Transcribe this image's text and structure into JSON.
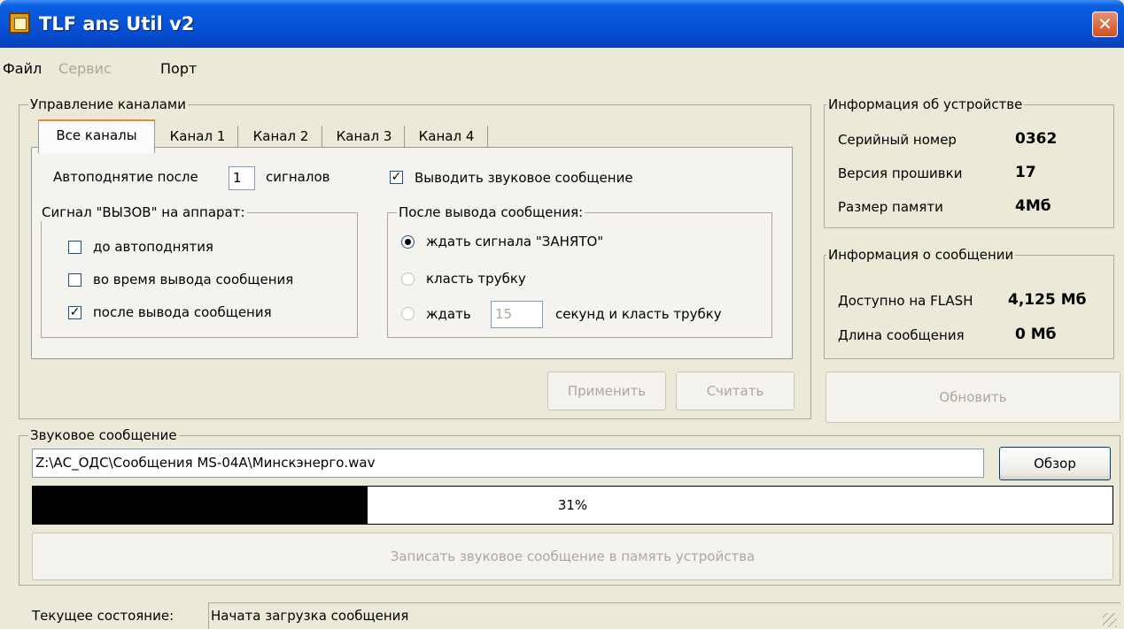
{
  "window": {
    "title": "TLF ans Util v2",
    "close_label": "✕"
  },
  "menu": {
    "file": "Файл",
    "service": "Сервис",
    "port": "Порт"
  },
  "channels": {
    "group_label": "Управление каналами",
    "tabs": [
      {
        "label": "Все каналы",
        "active": true
      },
      {
        "label": "Канал 1"
      },
      {
        "label": "Канал 2"
      },
      {
        "label": "Канал 3"
      },
      {
        "label": "Канал 4"
      }
    ],
    "autolift_prefix": "Автоподнятие после",
    "autolift_value": "1",
    "autolift_suffix": "сигналов",
    "play_sound_label": "Выводить звуковое сообщение",
    "play_sound_checked": true,
    "call_signal": {
      "group_label": "Сигнал \"ВЫЗОВ\" на аппарат:",
      "options": [
        {
          "label": "до автоподнятия",
          "checked": false
        },
        {
          "label": "во время вывода сообщения",
          "checked": false
        },
        {
          "label": "после вывода сообщения",
          "checked": true
        }
      ]
    },
    "after_message": {
      "group_label": "После вывода сообщения:",
      "wait_busy_label": "ждать сигнала \"ЗАНЯТО\"",
      "hang_up_label": "класть трубку",
      "wait_prefix": "ждать",
      "wait_seconds": "15",
      "wait_suffix": "секунд и класть трубку",
      "selected": "wait_busy"
    },
    "apply_label": "Применить",
    "read_label": "Считать"
  },
  "device_info": {
    "group_label": "Информация об устройстве",
    "serial_label": "Серийный номер",
    "serial_value": "0362",
    "firmware_label": "Версия прошивки",
    "firmware_value": "17",
    "memory_label": "Размер памяти",
    "memory_value": "4Мб"
  },
  "message_info": {
    "group_label": "Информация о сообщении",
    "flash_label": "Доступно на FLASH",
    "flash_value": "4,125 Мб",
    "length_label": "Длина сообщения",
    "length_value": "0 Мб",
    "refresh_label": "Обновить"
  },
  "sound": {
    "group_label": "Звуковое сообщение",
    "file_path": "Z:\\АС_ОДС\\Сообщения MS-04A\\Минскэнерго.wav",
    "browse_label": "Обзор",
    "progress_percent": 31,
    "progress_text": "31%",
    "write_label": "Записать звуковое сообщение в память устройства"
  },
  "status": {
    "label": "Текущее состояние:",
    "value": "Начата загрузка сообщения"
  },
  "colors": {
    "title_bar": "#0854d8",
    "face": "#ece9d8",
    "disabled_text": "#aca899",
    "progress_fill": "#000000"
  }
}
